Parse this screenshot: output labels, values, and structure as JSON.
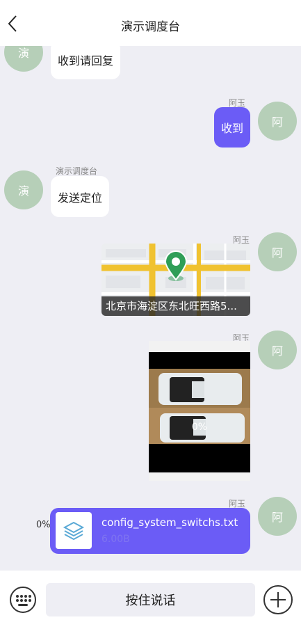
{
  "header": {
    "title": "演示调度台"
  },
  "icons": {
    "back": "chevron-left-icon",
    "location_pin": "location-pin-icon",
    "file": "layers-file-icon",
    "keyboard": "keyboard-icon",
    "plus": "plus-circle-icon"
  },
  "colors": {
    "accent": "#6b5cf6",
    "avatar": "#b6cfb8",
    "map_pin": "#2f9e57",
    "map_road": "#f0c230",
    "file_icon": "#5aa9d6"
  },
  "messages": {
    "msg1": {
      "avatar": "演",
      "text": "收到请回复"
    },
    "msg2": {
      "sender": "阿玉",
      "avatar": "阿",
      "text": "收到"
    },
    "msg3": {
      "sender": "演示调度台",
      "avatar": "演",
      "text": "发送定位"
    },
    "msg4": {
      "sender": "阿玉",
      "avatar": "阿",
      "caption": "北京市海淀区东北旺西路5..."
    },
    "msg5": {
      "sender": "阿玉",
      "avatar": "阿",
      "progress": "0%"
    },
    "msg6": {
      "sender": "阿玉",
      "avatar": "阿",
      "progress": "0%",
      "file_name": "config_system_switchs.txt",
      "file_size": "6.00B"
    }
  },
  "input_bar": {
    "hold_to_talk": "按住说话"
  }
}
